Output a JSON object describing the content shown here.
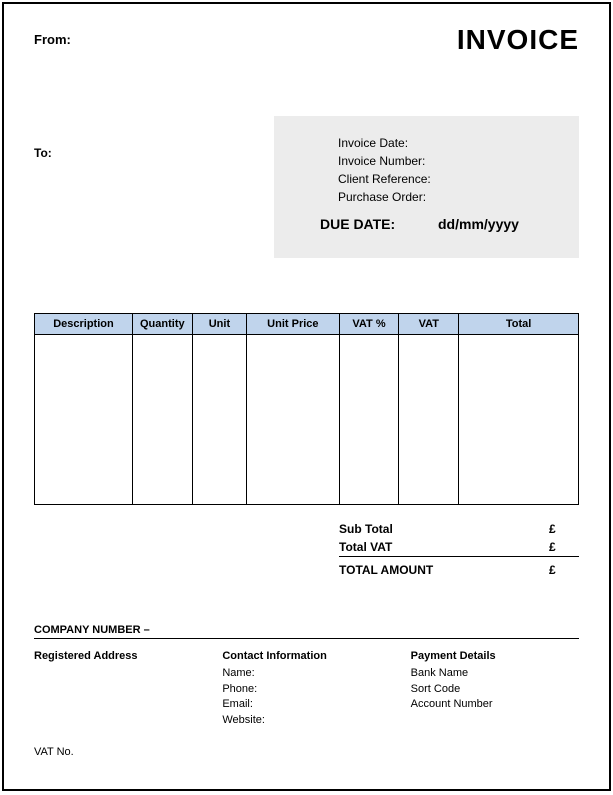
{
  "header": {
    "from_label": "From:",
    "title": "INVOICE"
  },
  "to_label": "To:",
  "meta": {
    "invoice_date_label": "Invoice Date:",
    "invoice_number_label": "Invoice Number:",
    "client_reference_label": "Client Reference:",
    "purchase_order_label": "Purchase Order:",
    "due_date_label": "DUE DATE:",
    "due_date_value": "dd/mm/yyyy"
  },
  "table": {
    "headers": {
      "description": "Description",
      "quantity": "Quantity",
      "unit": "Unit",
      "unit_price": "Unit Price",
      "vat_percent": "VAT %",
      "vat": "VAT",
      "total": "Total"
    }
  },
  "totals": {
    "sub_total_label": "Sub Total",
    "total_vat_label": "Total VAT",
    "total_amount_label": "TOTAL AMOUNT",
    "currency": "£"
  },
  "company_number_label": "COMPANY NUMBER –",
  "footer": {
    "registered_address_title": "Registered Address",
    "contact_title": "Contact Information",
    "contact_name_label": "Name:",
    "contact_phone_label": "Phone:",
    "contact_email_label": "Email:",
    "contact_website_label": "Website:",
    "payment_title": "Payment Details",
    "bank_name_label": "Bank Name",
    "sort_code_label": "Sort Code",
    "account_number_label": "Account Number"
  },
  "vat_no_label": "VAT No."
}
